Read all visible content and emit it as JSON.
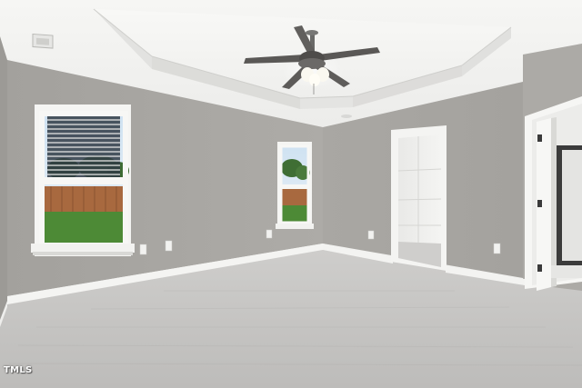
{
  "photo": {
    "subject": "empty-bedroom-interior",
    "watermark_text": "TMLS"
  },
  "colors": {
    "wall": "#a8a6a2",
    "ceiling": "#f3f3f1",
    "carpet": "#c4c3c1",
    "trim": "#f7f7f5"
  }
}
